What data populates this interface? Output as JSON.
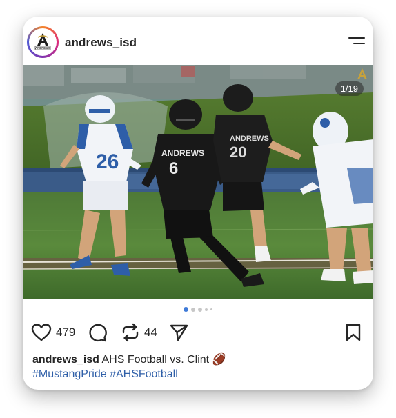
{
  "post": {
    "username": "andrews_isd",
    "avatar_label": "ANDREWS",
    "image_counter": "1/19",
    "carousel": {
      "total_dots": 5,
      "active_index": 0
    },
    "jersey_text_home": "ANDREWS",
    "likes": "479",
    "reposts": "44",
    "caption_text": "AHS Football vs. Clint 🏈",
    "hashtags": "#MustangPride #AHSFootball",
    "colors": {
      "text": "#262626",
      "hashtag": "#2f5fa8",
      "active_dot": "#3f7bd8"
    },
    "icons": {
      "menu": "menu-icon",
      "like": "heart-icon",
      "comment": "comment-icon",
      "repost": "repost-icon",
      "share": "send-icon",
      "save": "bookmark-icon"
    }
  }
}
